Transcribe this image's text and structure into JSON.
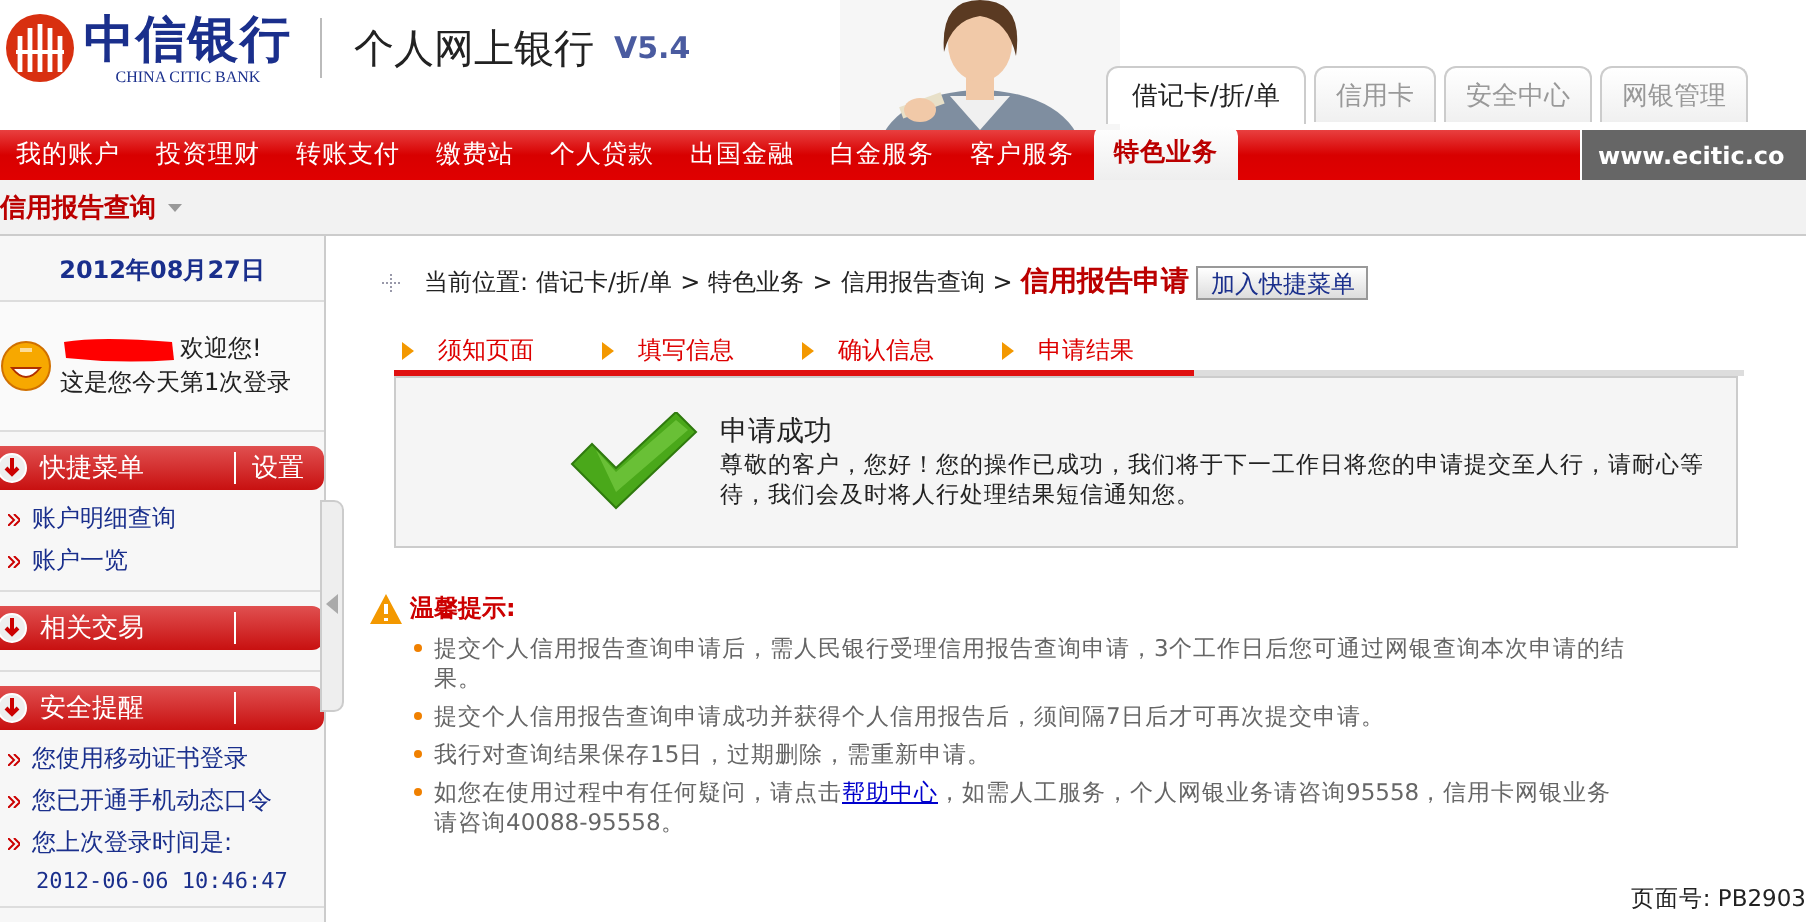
{
  "header": {
    "bank_name": "中信银行",
    "bank_name_en": "CHINA CITIC BANK",
    "product": "个人网上银行",
    "version": "V5.4",
    "tabs": [
      {
        "label": "借记卡/折/单",
        "selected": true
      },
      {
        "label": "信用卡",
        "selected": false
      },
      {
        "label": "安全中心",
        "selected": false
      },
      {
        "label": "网银管理",
        "selected": false
      }
    ]
  },
  "nav": {
    "items": [
      {
        "label": "我的账户",
        "selected": false
      },
      {
        "label": "投资理财",
        "selected": false
      },
      {
        "label": "转账支付",
        "selected": false
      },
      {
        "label": "缴费站",
        "selected": false
      },
      {
        "label": "个人贷款",
        "selected": false
      },
      {
        "label": "出国金融",
        "selected": false
      },
      {
        "label": "白金服务",
        "selected": false
      },
      {
        "label": "客户服务",
        "selected": false
      },
      {
        "label": "特色业务",
        "selected": true
      }
    ],
    "site": "www.ecitic.co"
  },
  "subbar": {
    "title": "信用报告查询"
  },
  "sidebar": {
    "date": "2012年08月27日",
    "welcome": "欢迎您!",
    "login_note": "这是您今天第1次登录",
    "sections": [
      {
        "title": "快捷菜单",
        "action": "设置",
        "items": [
          "账户明细查询",
          "账户一览"
        ]
      },
      {
        "title": "相关交易"
      },
      {
        "title": "安全提醒",
        "items": [
          "您使用移动证书登录",
          "您已开通手机动态口令",
          "您上次登录时间是:"
        ],
        "note": "2012-06-06 10:46:47"
      }
    ]
  },
  "breadcrumb": {
    "label": "当前位置:",
    "path": [
      "借记卡/折/单",
      "特色业务",
      "信用报告查询"
    ],
    "separator": ">",
    "current": "信用报告申请",
    "button": "加入快捷菜单"
  },
  "steps": [
    {
      "label": "须知页面",
      "completed": true
    },
    {
      "label": "填写信息",
      "completed": true
    },
    {
      "label": "确认信息",
      "completed": true
    },
    {
      "label": "申请结果",
      "completed": true
    }
  ],
  "result": {
    "title": "申请成功",
    "message": "尊敬的客户，您好！您的操作已成功，我们将于下一工作日将您的申请提交至人行，请耐心等待，我们会及时将人行处理结果短信通知您。"
  },
  "tips": {
    "title": "温馨提示:",
    "items": [
      {
        "text": "提交个人信用报告查询申请后，需人民银行受理信用报告查询申请，3个工作日后您可通过网银查询本次申请的结果。"
      },
      {
        "text": "提交个人信用报告查询申请成功并获得个人信用报告后，须间隔7日后才可再次提交申请。"
      },
      {
        "text": "我行对查询结果保存15日，过期删除，需重新申请。"
      },
      {
        "text": "如您在使用过程中有任何疑问，请点击",
        "link": "帮助中心",
        "after": "，如需人工服务，个人网银业务请咨询95558，信用卡网银业务请咨询40088-95558。"
      }
    ]
  },
  "page_id": "页面号: PB2903"
}
